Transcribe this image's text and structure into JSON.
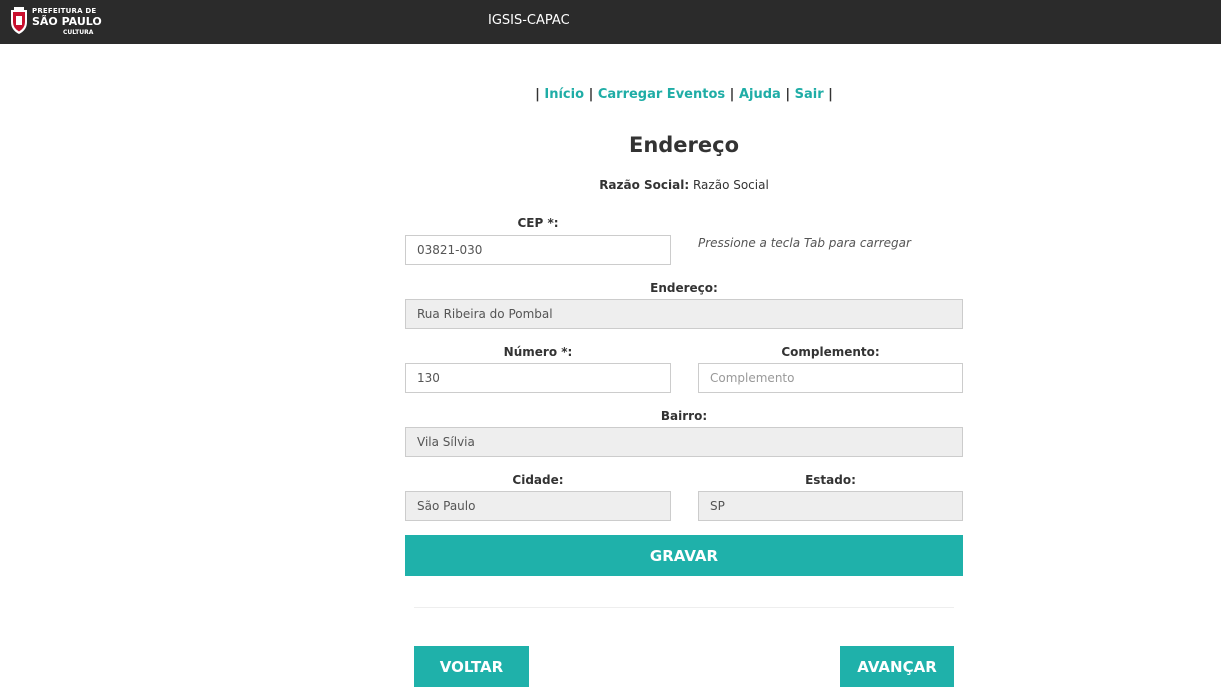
{
  "header": {
    "logo_line1": "PREFEITURA DE",
    "logo_line2": "SÃO PAULO",
    "logo_line3": "CULTURA",
    "app_title": "IGSIS-CAPAC"
  },
  "nav": {
    "sep": "|",
    "items": [
      {
        "label": "Início"
      },
      {
        "label": "Carregar Eventos"
      },
      {
        "label": "Ajuda"
      },
      {
        "label": "Sair"
      }
    ]
  },
  "page": {
    "title": "Endereço",
    "razao_label": "Razão Social:",
    "razao_value": "Razão Social"
  },
  "form": {
    "cep": {
      "label": "CEP *:",
      "value": "03821-030",
      "hint": "Pressione a tecla Tab para carregar"
    },
    "endereco": {
      "label": "Endereço:",
      "value": "Rua Ribeira do Pombal"
    },
    "numero": {
      "label": "Número *:",
      "value": "130"
    },
    "complemento": {
      "label": "Complemento:",
      "value": "",
      "placeholder": "Complemento"
    },
    "bairro": {
      "label": "Bairro:",
      "value": "Vila Sílvia"
    },
    "cidade": {
      "label": "Cidade:",
      "value": "São Paulo"
    },
    "estado": {
      "label": "Estado:",
      "value": "SP"
    }
  },
  "buttons": {
    "gravar": "GRAVAR",
    "voltar": "VOLTAR",
    "avancar": "AVANÇAR"
  },
  "colors": {
    "accent": "#1fb1aa",
    "link": "#1fada6",
    "topbar": "#2b2b2b",
    "readonly_bg": "#eeeeee"
  }
}
